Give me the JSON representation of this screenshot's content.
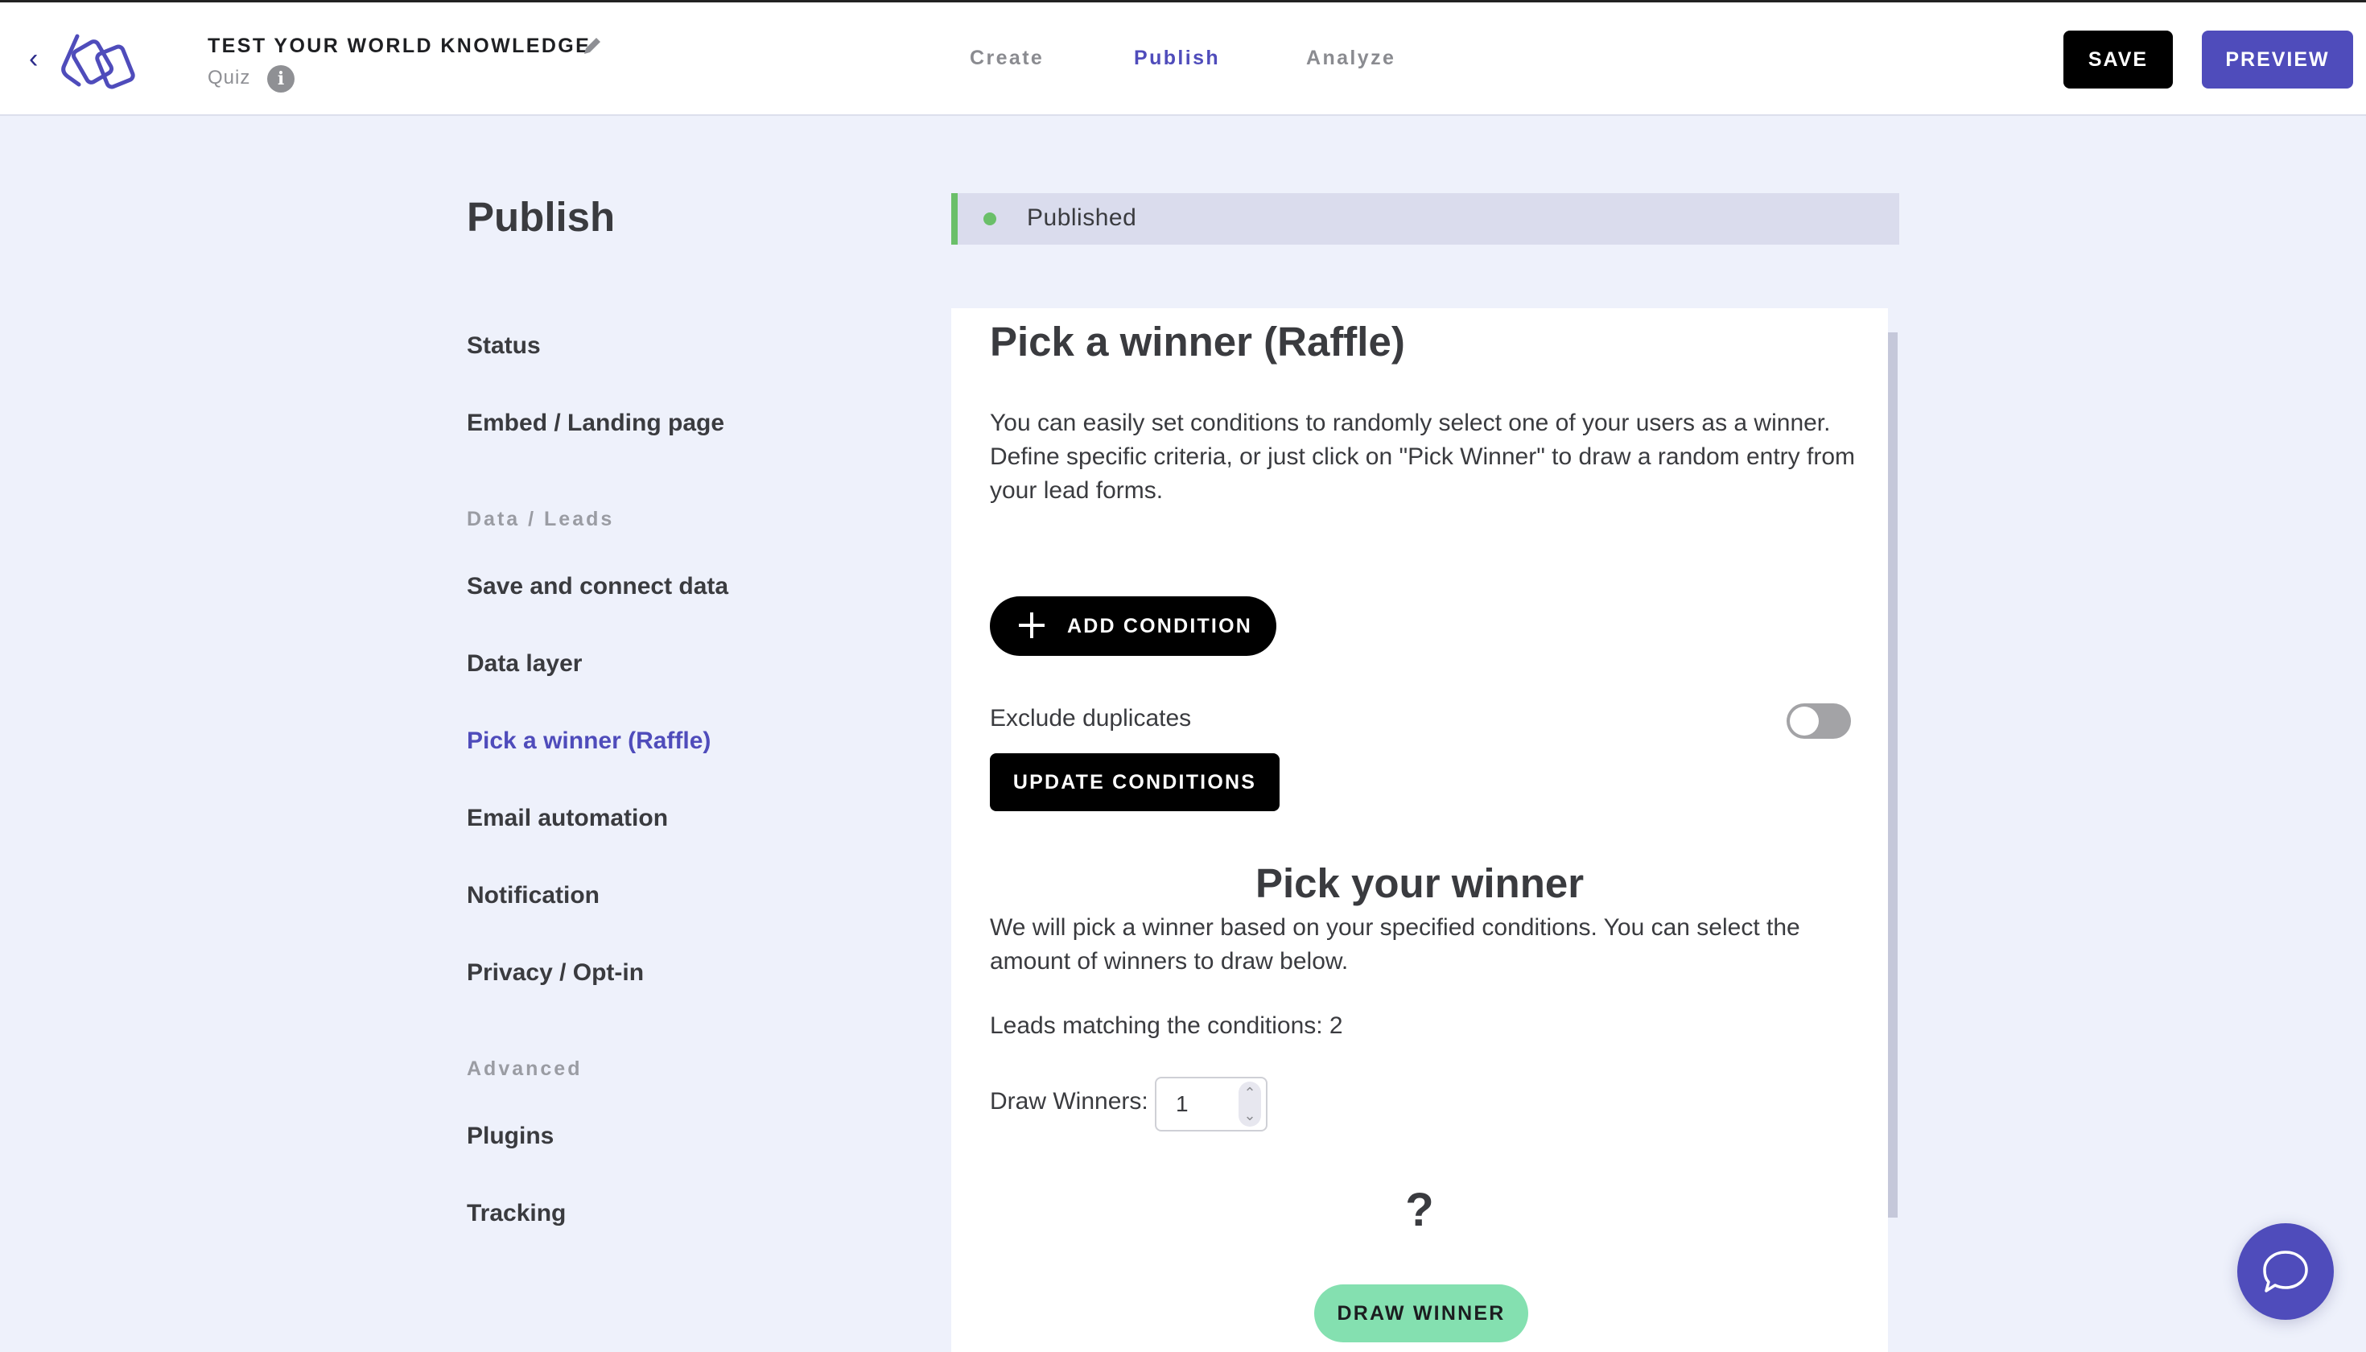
{
  "header": {
    "back_icon": "chevron-left-icon",
    "logo_icon": "app-logo",
    "title": "TEST YOUR WORLD KNOWLEDGE",
    "edit_icon": "pencil-icon",
    "subtitle": "Quiz",
    "info_icon": "info-icon",
    "info_glyph": "i",
    "tabs": [
      {
        "label": "Create",
        "active": false
      },
      {
        "label": "Publish",
        "active": true
      },
      {
        "label": "Analyze",
        "active": false
      }
    ],
    "save_label": "SAVE",
    "preview_label": "PREVIEW"
  },
  "sidebar": {
    "title": "Publish",
    "items": [
      {
        "label": "Status"
      },
      {
        "label": "Embed / Landing page"
      },
      {
        "group": "Data / Leads"
      },
      {
        "label": "Save and connect data"
      },
      {
        "label": "Data layer"
      },
      {
        "label": "Pick a winner (Raffle)",
        "active": true
      },
      {
        "label": "Email automation"
      },
      {
        "label": "Notification"
      },
      {
        "label": "Privacy / Opt-in"
      },
      {
        "group": "Advanced"
      },
      {
        "label": "Plugins"
      },
      {
        "label": "Tracking"
      }
    ]
  },
  "status": {
    "label": "Published",
    "color": "#6abf69"
  },
  "main": {
    "title": "Pick a winner (Raffle)",
    "description": "You can easily set conditions to randomly select one of your users as a winner. Define specific criteria, or just click on \"Pick Winner\" to draw a random entry from your lead forms.",
    "add_condition_label": "ADD CONDITION",
    "exclude_duplicates_label": "Exclude duplicates",
    "exclude_duplicates_on": false,
    "update_conditions_label": "UPDATE CONDITIONS",
    "pick_title": "Pick your winner",
    "pick_description": "We will pick a winner based on your specified conditions. You can select the amount of winners to draw below.",
    "leads_matching": "Leads matching the conditions: 2",
    "draw_winners_label": "Draw Winners:",
    "draw_winners_value": "1",
    "winner_placeholder": "?",
    "draw_winner_label": "DRAW WINNER"
  },
  "colors": {
    "accent": "#4f4cbb",
    "success": "#6abf69",
    "draw_button": "#84e0b0",
    "background": "#eef1fb"
  },
  "chat": {
    "icon": "chat-bubble-icon"
  }
}
